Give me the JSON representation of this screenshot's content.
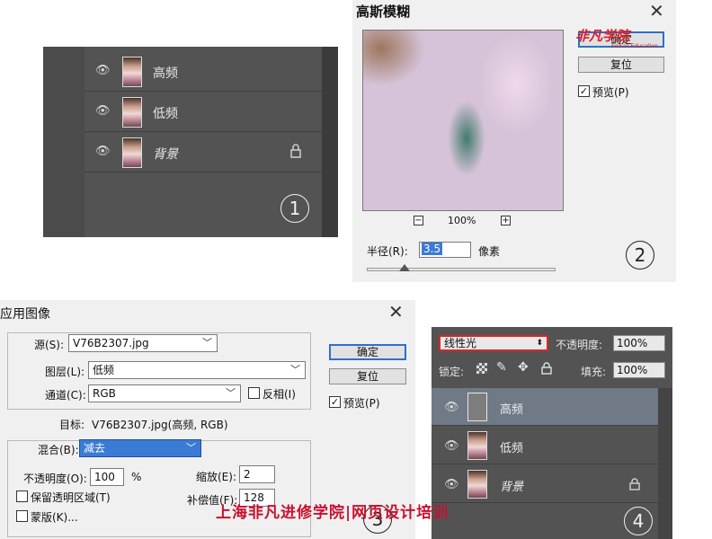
{
  "panel1": {
    "layers": [
      {
        "name": "高频",
        "locked": false
      },
      {
        "name": "低频",
        "locked": false
      },
      {
        "name": "背景",
        "locked": true
      }
    ],
    "number": "1"
  },
  "panel2": {
    "title": "高斯模糊",
    "ok_label": "确定",
    "reset_label": "复位",
    "preview_label": "预览(P)",
    "preview_checked": "✓",
    "zoom": "100%",
    "radius_label": "半径(R):",
    "radius_value": "3.5",
    "radius_unit": "像素",
    "slider_level": 0.2,
    "number": "2"
  },
  "panel3": {
    "title": "应用图像",
    "source_label": "源(S):",
    "source_value": "V76B2307.jpg",
    "layer_label": "图层(L):",
    "layer_value": "低频",
    "channel_label": "通道(C):",
    "channel_value": "RGB",
    "invert_label": "反相(I)",
    "target_label": "目标:",
    "target_value": "V76B2307.jpg(高频, RGB)",
    "blending_label": "混合(B):",
    "blending_value": "减去",
    "opacity_label": "不透明度(O):",
    "opacity_value": "100",
    "opacity_unit": "%",
    "scale_label": "缩放(E):",
    "scale_value": "2",
    "offset_label": "补偿值(F):",
    "offset_value": "128",
    "preserve_label": "保留透明区域(T)",
    "mask_label": "蒙版(K)...",
    "ok_label": "确定",
    "reset_label": "复位",
    "preview_label": "预览(P)",
    "preview_checked": "✓",
    "number": "3"
  },
  "panel4": {
    "blend_mode": "线性光",
    "opacity_label": "不透明度:",
    "opacity_value": "100%",
    "lock_label": "锁定:",
    "fill_label": "填充:",
    "fill_value": "100%",
    "layers": [
      {
        "name": "高频",
        "selected": true
      },
      {
        "name": "低频",
        "selected": false
      },
      {
        "name": "背景",
        "selected": false,
        "locked": true
      }
    ],
    "number": "4"
  },
  "watermark": "上海非凡进修学院|网页设计培训",
  "logo": "非凡学院",
  "logo_sub": "FeiFan Education",
  "colors": {
    "accent_red": "#d81e2c",
    "selected_layer": "#6f7a86",
    "panel_dark": "#535353",
    "dialog_bg": "#f0f0f0"
  }
}
